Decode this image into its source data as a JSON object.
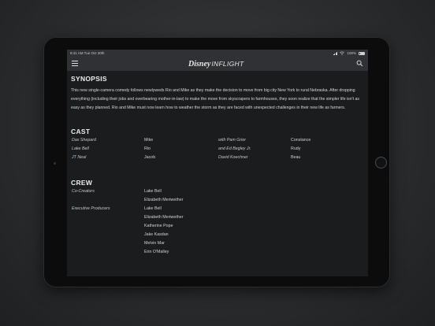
{
  "status_bar": {
    "time": "9:41 AM   Tue Oct 30th",
    "battery": "100%",
    "battery_level": 1.0
  },
  "app": {
    "brand_disney": "Disney",
    "brand_inflight": "INFLIGHT"
  },
  "synopsis": {
    "heading": "SYNOPSIS",
    "text": "This new single-camera comedy follows newlyweds Rio and Mike as they make the decision to move from big city New York to rural Nebraska. After dropping everything (including their jobs and overbearing mother-in-law) to make the move from skyscrapers to farmhouses, they soon realize that the simpler life isn't as easy as they planned. Rio and Mike must now learn how to weather the storm as they are faced with unexpected challenges in their new life as farmers."
  },
  "cast": {
    "heading": "CAST",
    "rows": [
      {
        "actor": "Dax Shepard",
        "role": "Mike",
        "actor2": "with Pam Grier",
        "role2": "Constance"
      },
      {
        "actor": "Lake Bell",
        "role": "Rio",
        "actor2": "and Ed Begley Jr.",
        "role2": "Rudy"
      },
      {
        "actor": "JT Neal",
        "role": "Jacob",
        "actor2": "David Koechner",
        "role2": "Beau"
      }
    ]
  },
  "crew": {
    "heading": "CREW",
    "groups": [
      {
        "title": "Co-Creators",
        "names": [
          "Lake Bell",
          "Elizabeth Meriwether"
        ]
      },
      {
        "title": "Executive Producers",
        "names": [
          "Lake Bell",
          "Elizabeth Meriwether",
          "Katherine Pope",
          "Jake Kasdan",
          "Melvin Mar",
          "Erin O'Malley"
        ]
      }
    ]
  }
}
